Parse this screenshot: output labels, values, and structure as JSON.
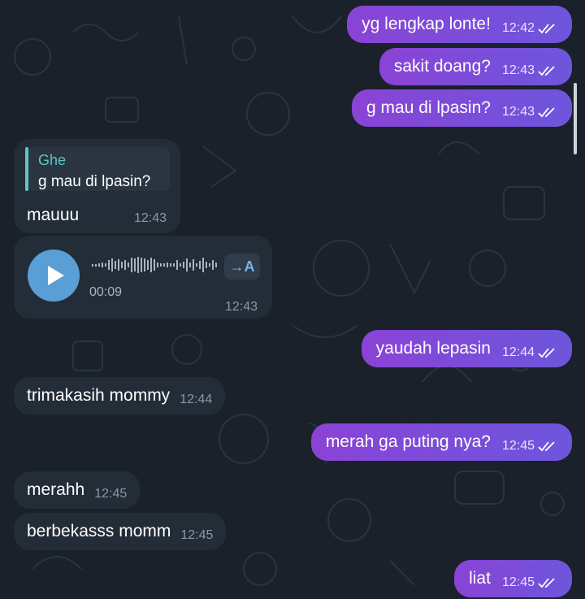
{
  "chat": {
    "messages": [
      {
        "dir": "out",
        "text": "yg lengkap lonte!",
        "time": "12:42"
      },
      {
        "dir": "out",
        "text": "sakit doang?",
        "time": "12:43"
      },
      {
        "dir": "out",
        "text": "g mau di lpasin?",
        "time": "12:43"
      },
      {
        "dir": "in",
        "reply_to": {
          "name": "Ghe",
          "text": "g mau di lpasin?"
        },
        "text": "mauuu",
        "time": "12:43"
      },
      {
        "dir": "in",
        "type": "voice",
        "duration": "00:09",
        "transcribe_label": "→A",
        "time": "12:43"
      },
      {
        "dir": "out",
        "text": "yaudah lepasin",
        "time": "12:44"
      },
      {
        "dir": "in",
        "text": "trimakasih mommy",
        "time": "12:44"
      },
      {
        "dir": "out",
        "text": "merah ga puting nya?",
        "time": "12:45"
      },
      {
        "dir": "in",
        "text": "merahh",
        "time": "12:45"
      },
      {
        "dir": "in",
        "text": "berbekasss momm",
        "time": "12:45"
      },
      {
        "dir": "out",
        "text": "liat",
        "time": "12:45"
      }
    ]
  },
  "colors": {
    "background": "#1a212a",
    "incoming_bubble": "#232d38",
    "outgoing_start": "#8a43d6",
    "outgoing_end": "#6d56dc",
    "reply_accent": "#5fc6c3",
    "play_button": "#5a9ed6"
  },
  "icons": [
    "play-icon",
    "read-receipt-double-check-icon",
    "transcribe-icon"
  ]
}
